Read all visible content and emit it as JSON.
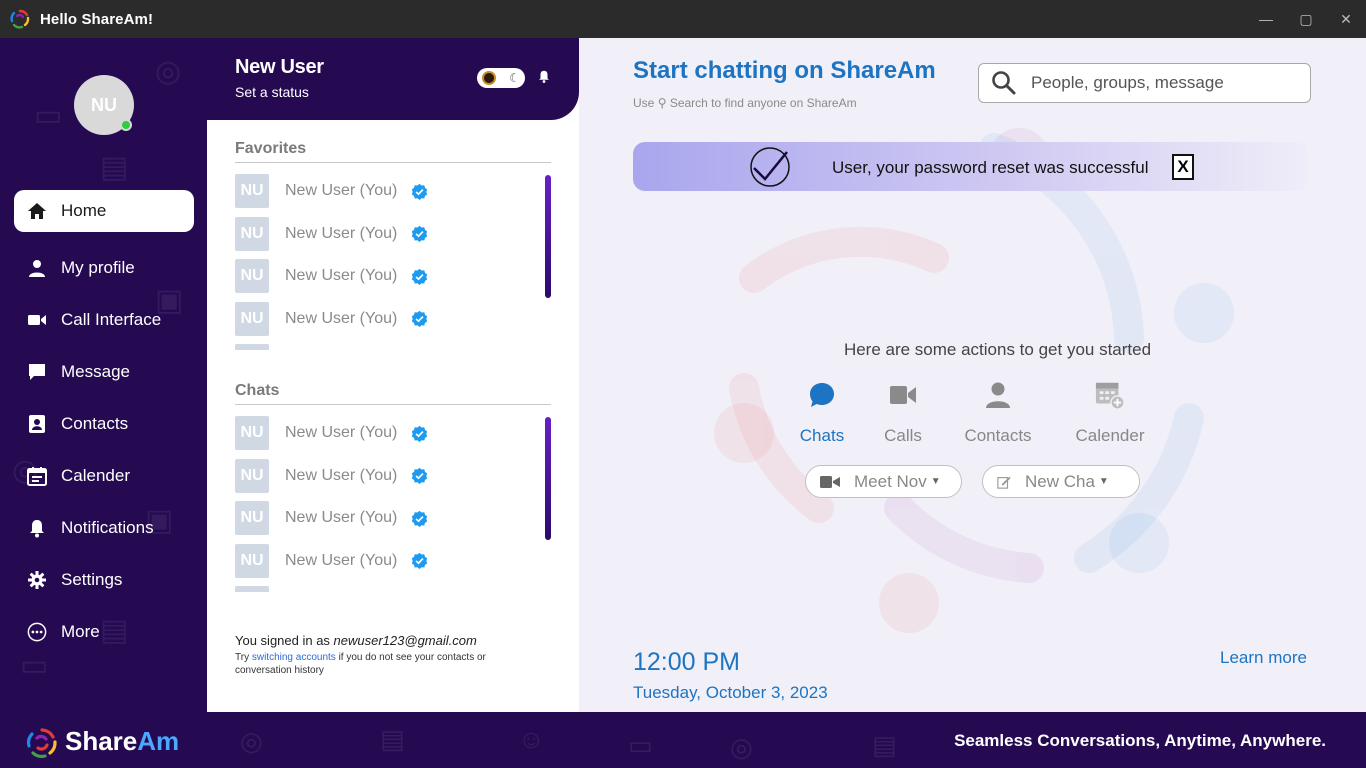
{
  "window": {
    "title": "Hello ShareAm!",
    "controls": [
      "—",
      "▢",
      "✕"
    ]
  },
  "user": {
    "initials": "NU",
    "name": "New User",
    "status": "Set a status"
  },
  "nav": [
    {
      "label": "Home",
      "icon": "home-icon"
    },
    {
      "label": "My profile",
      "icon": "person-icon"
    },
    {
      "label": "Call Interface",
      "icon": "video-icon"
    },
    {
      "label": "Message",
      "icon": "message-icon"
    },
    {
      "label": "Contacts",
      "icon": "contact-card-icon"
    },
    {
      "label": "Calender",
      "icon": "calendar-icon"
    },
    {
      "label": "Notifications",
      "icon": "bell-icon"
    },
    {
      "label": "Settings",
      "icon": "gear-icon"
    },
    {
      "label": "More",
      "icon": "more-icon"
    }
  ],
  "favorites": {
    "title": "Favorites",
    "items": [
      {
        "initials": "NU",
        "name": "New User (You)"
      },
      {
        "initials": "NU",
        "name": "New User (You)"
      },
      {
        "initials": "NU",
        "name": "New User (You)"
      },
      {
        "initials": "NU",
        "name": "New User (You)"
      }
    ]
  },
  "chats": {
    "title": "Chats",
    "items": [
      {
        "initials": "NU",
        "name": "New User (You)"
      },
      {
        "initials": "NU",
        "name": "New User (You)"
      },
      {
        "initials": "NU",
        "name": "New User (You)"
      },
      {
        "initials": "NU",
        "name": "New User (You)"
      }
    ]
  },
  "signin": {
    "prefix": "You signed in as ",
    "email": "newuser123@gmail.com",
    "note_before": "Try ",
    "note_link": "switching accounts",
    "note_after": " if you do not see your contacts or conversation history"
  },
  "main": {
    "title": "Start chatting on ShareAm",
    "sub_before": "Use ",
    "sub_after": " Search to find anyone on ShareAm",
    "search_placeholder": "People, groups, message",
    "banner_message": "User, your password reset was successful",
    "banner_close": "X",
    "actions_title": "Here are some actions to get you started",
    "actions": [
      {
        "label": "Chats",
        "icon": "chat-bubble-icon",
        "active": true
      },
      {
        "label": "Calls",
        "icon": "video-icon",
        "active": false
      },
      {
        "label": "Contacts",
        "icon": "person-icon",
        "active": false
      },
      {
        "label": "Calender",
        "icon": "calendar-add-icon",
        "active": false
      }
    ],
    "meet_now": "Meet Nov",
    "new_chat": "New Cha",
    "time": "12:00 PM",
    "date": "Tuesday, October 3, 2023",
    "learn_more": "Learn more"
  },
  "footer": {
    "brand_share": "Share",
    "brand_am": "Am",
    "tagline": "Seamless Conversations, Anytime, Anywhere."
  },
  "colors": {
    "purple_dark": "#250a52",
    "accent_blue": "#1d74c2",
    "verified_blue": "#1d9bf0",
    "online_green": "#2ecc40"
  }
}
